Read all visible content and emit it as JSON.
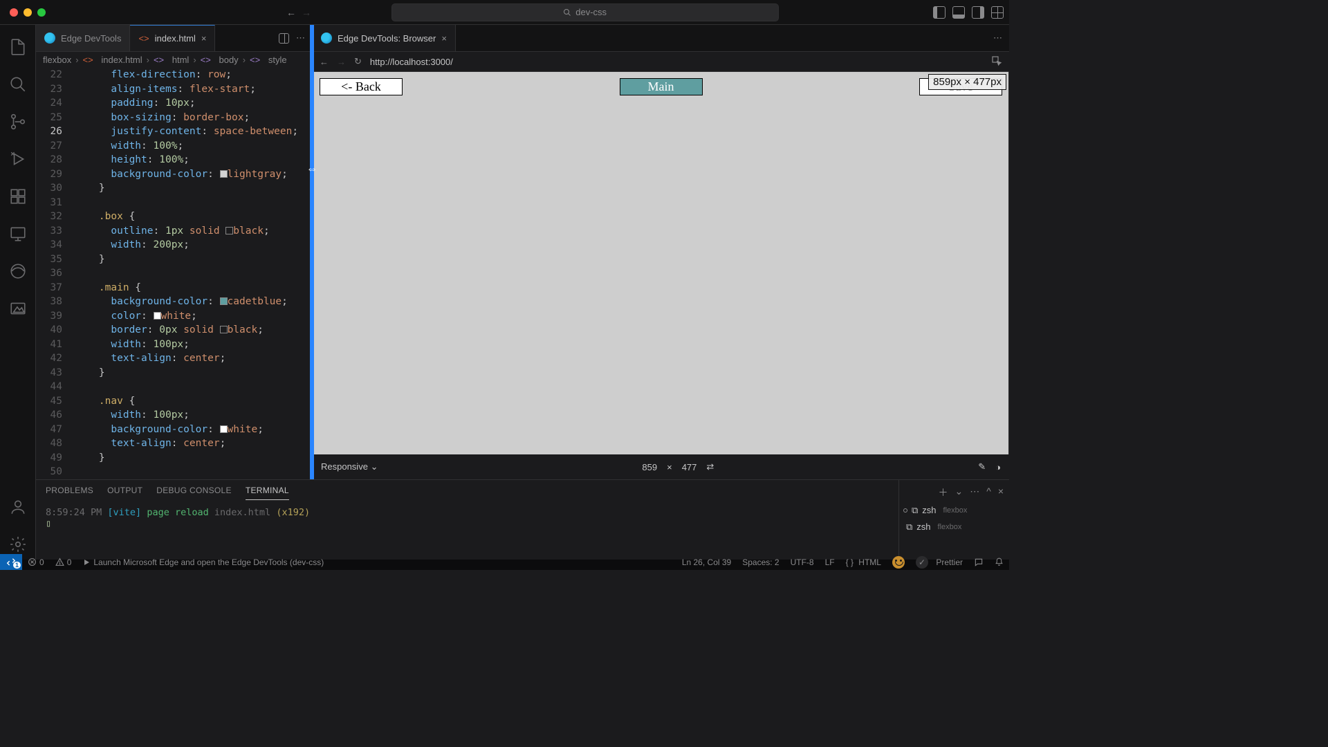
{
  "title_search": "dev-css",
  "tabs": {
    "left": [
      {
        "label": "Edge DevTools",
        "active": false,
        "kind": "edge"
      },
      {
        "label": "index.html",
        "active": true,
        "kind": "html"
      }
    ],
    "right": [
      {
        "label": "Edge DevTools: Browser",
        "active": true,
        "kind": "edge"
      }
    ]
  },
  "breadcrumbs": [
    "flexbox",
    "index.html",
    "html",
    "body",
    "style"
  ],
  "code": {
    "first_line": 22,
    "highlight_line": 26,
    "lines": [
      [
        [
          "prop",
          "flex-direction"
        ],
        [
          "punct",
          ": "
        ],
        [
          "val",
          "row"
        ],
        [
          "punct",
          ";"
        ]
      ],
      [
        [
          "prop",
          "align-items"
        ],
        [
          "punct",
          ": "
        ],
        [
          "val",
          "flex-start"
        ],
        [
          "punct",
          ";"
        ]
      ],
      [
        [
          "prop",
          "padding"
        ],
        [
          "punct",
          ": "
        ],
        [
          "const",
          "10px"
        ],
        [
          "punct",
          ";"
        ]
      ],
      [
        [
          "prop",
          "box-sizing"
        ],
        [
          "punct",
          ": "
        ],
        [
          "val",
          "border-box"
        ],
        [
          "punct",
          ";"
        ]
      ],
      [
        [
          "prop",
          "justify-content"
        ],
        [
          "punct",
          ": "
        ],
        [
          "val",
          "space-between"
        ],
        [
          "punct",
          ";"
        ]
      ],
      [
        [
          "prop",
          "width"
        ],
        [
          "punct",
          ": "
        ],
        [
          "const",
          "100%"
        ],
        [
          "punct",
          ";"
        ]
      ],
      [
        [
          "prop",
          "height"
        ],
        [
          "punct",
          ": "
        ],
        [
          "const",
          "100%"
        ],
        [
          "punct",
          ";"
        ]
      ],
      [
        [
          "prop",
          "background-color"
        ],
        [
          "punct",
          ": "
        ],
        [
          "swatch",
          "lightgray"
        ],
        [
          "val",
          "lightgray"
        ],
        [
          "punct",
          ";"
        ]
      ],
      [
        [
          "punct",
          "}"
        ]
      ],
      [],
      [
        [
          "sel",
          ".box"
        ],
        [
          "punct",
          " {"
        ]
      ],
      [
        [
          "prop",
          "outline"
        ],
        [
          "punct",
          ": "
        ],
        [
          "const",
          "1px"
        ],
        [
          "punct",
          " "
        ],
        [
          "val",
          "solid"
        ],
        [
          "punct",
          " "
        ],
        [
          "swatch",
          "black"
        ],
        [
          "val",
          "black"
        ],
        [
          "punct",
          ";"
        ]
      ],
      [
        [
          "prop",
          "width"
        ],
        [
          "punct",
          ": "
        ],
        [
          "const",
          "200px"
        ],
        [
          "punct",
          ";"
        ]
      ],
      [
        [
          "punct",
          "}"
        ]
      ],
      [],
      [
        [
          "sel",
          ".main"
        ],
        [
          "punct",
          " {"
        ]
      ],
      [
        [
          "prop",
          "background-color"
        ],
        [
          "punct",
          ": "
        ],
        [
          "swatch",
          "cadetblue"
        ],
        [
          "val",
          "cadetblue"
        ],
        [
          "punct",
          ";"
        ]
      ],
      [
        [
          "prop",
          "color"
        ],
        [
          "punct",
          ": "
        ],
        [
          "swatch",
          "white"
        ],
        [
          "val",
          "white"
        ],
        [
          "punct",
          ";"
        ]
      ],
      [
        [
          "prop",
          "border"
        ],
        [
          "punct",
          ": "
        ],
        [
          "const",
          "0px"
        ],
        [
          "punct",
          " "
        ],
        [
          "val",
          "solid"
        ],
        [
          "punct",
          " "
        ],
        [
          "swatch",
          "black"
        ],
        [
          "val",
          "black"
        ],
        [
          "punct",
          ";"
        ]
      ],
      [
        [
          "prop",
          "width"
        ],
        [
          "punct",
          ": "
        ],
        [
          "const",
          "100px"
        ],
        [
          "punct",
          ";"
        ]
      ],
      [
        [
          "prop",
          "text-align"
        ],
        [
          "punct",
          ": "
        ],
        [
          "val",
          "center"
        ],
        [
          "punct",
          ";"
        ]
      ],
      [
        [
          "punct",
          "}"
        ]
      ],
      [],
      [
        [
          "sel",
          ".nav"
        ],
        [
          "punct",
          " {"
        ]
      ],
      [
        [
          "prop",
          "width"
        ],
        [
          "punct",
          ": "
        ],
        [
          "const",
          "100px"
        ],
        [
          "punct",
          ";"
        ]
      ],
      [
        [
          "prop",
          "background-color"
        ],
        [
          "punct",
          ": "
        ],
        [
          "swatch",
          "white"
        ],
        [
          "val",
          "white"
        ],
        [
          "punct",
          ";"
        ]
      ],
      [
        [
          "prop",
          "text-align"
        ],
        [
          "punct",
          ": "
        ],
        [
          "val",
          "center"
        ],
        [
          "punct",
          ";"
        ]
      ],
      [
        [
          "punct",
          "}"
        ]
      ],
      []
    ],
    "base_indent": "      ",
    "close_indent": "    "
  },
  "preview": {
    "url": "http://localhost:3000/",
    "boxes": {
      "back": "<- Back",
      "main": "Main",
      "save": "Save"
    },
    "size_overlay": "859px × 477px",
    "device": "Responsive",
    "width": "859",
    "times": "×",
    "height": "477"
  },
  "panel": {
    "tabs": [
      "PROBLEMS",
      "OUTPUT",
      "DEBUG CONSOLE",
      "TERMINAL"
    ],
    "active_tab": "TERMINAL",
    "line_time": "8:59:24 PM",
    "line_vite": "[vite]",
    "line_msg": "page reload",
    "line_file": "index.html",
    "line_count": "(x192)",
    "terminals": [
      {
        "shell": "zsh",
        "dir": "flexbox"
      },
      {
        "shell": "zsh",
        "dir": "flexbox"
      }
    ]
  },
  "status": {
    "remote_badge": "1",
    "errors": "0",
    "warnings": "0",
    "launch": "Launch Microsoft Edge and open the Edge DevTools (dev-css)",
    "cursor": "Ln 26, Col 39",
    "spaces": "Spaces: 2",
    "encoding": "UTF-8",
    "eol": "LF",
    "lang": "HTML",
    "prettier": "Prettier"
  },
  "swatch_colors": {
    "lightgray": "#d3d3d3",
    "black": "transparent",
    "cadetblue": "#5f9ea0",
    "white": "#ffffff"
  }
}
